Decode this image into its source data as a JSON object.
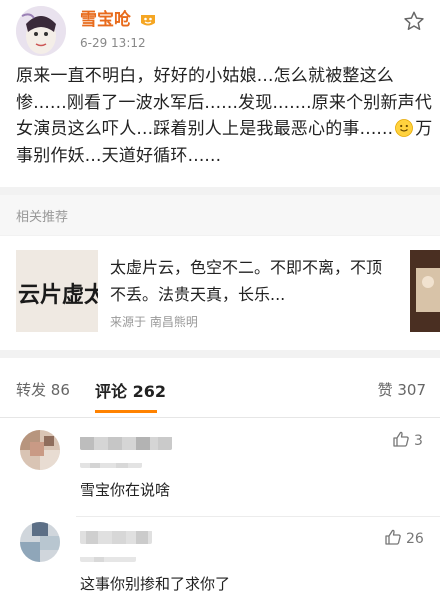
{
  "post": {
    "username": "雪宝呛",
    "timestamp": "6-29 13:12",
    "text_part1": "原来一直不明白，好好的小姑娘...怎么就被整这么惨......刚看了一波水军后......发现.......原来个别新声代女演员这么吓人...踩着别人上是我最恶心的事......",
    "text_part2": "万事别作妖...天道好循环......",
    "icons": {
      "avatar": "avatar",
      "badge": "vip-badge-icon",
      "star": "star-icon",
      "emoji": "smile-emoji-icon"
    }
  },
  "related": {
    "header": "相关推荐",
    "text": "太虚片云，色空不二。不即不离，不顶不丢。法贵天真，长乐...",
    "source": "来源于 南昌熊明",
    "thumb_text": "云片虚太"
  },
  "tabs": {
    "repost_label": "转发",
    "repost_count": "86",
    "comment_label": "评论",
    "comment_count": "262",
    "like_label": "赞",
    "like_count": "307"
  },
  "comments": [
    {
      "text": "雪宝你在说啥",
      "likes": "3"
    },
    {
      "text": "这事你别掺和了求你了",
      "likes": "26"
    }
  ],
  "colors": {
    "username": "#e86b1c",
    "accent": "#ff8200",
    "background": "#f2f2f2"
  }
}
